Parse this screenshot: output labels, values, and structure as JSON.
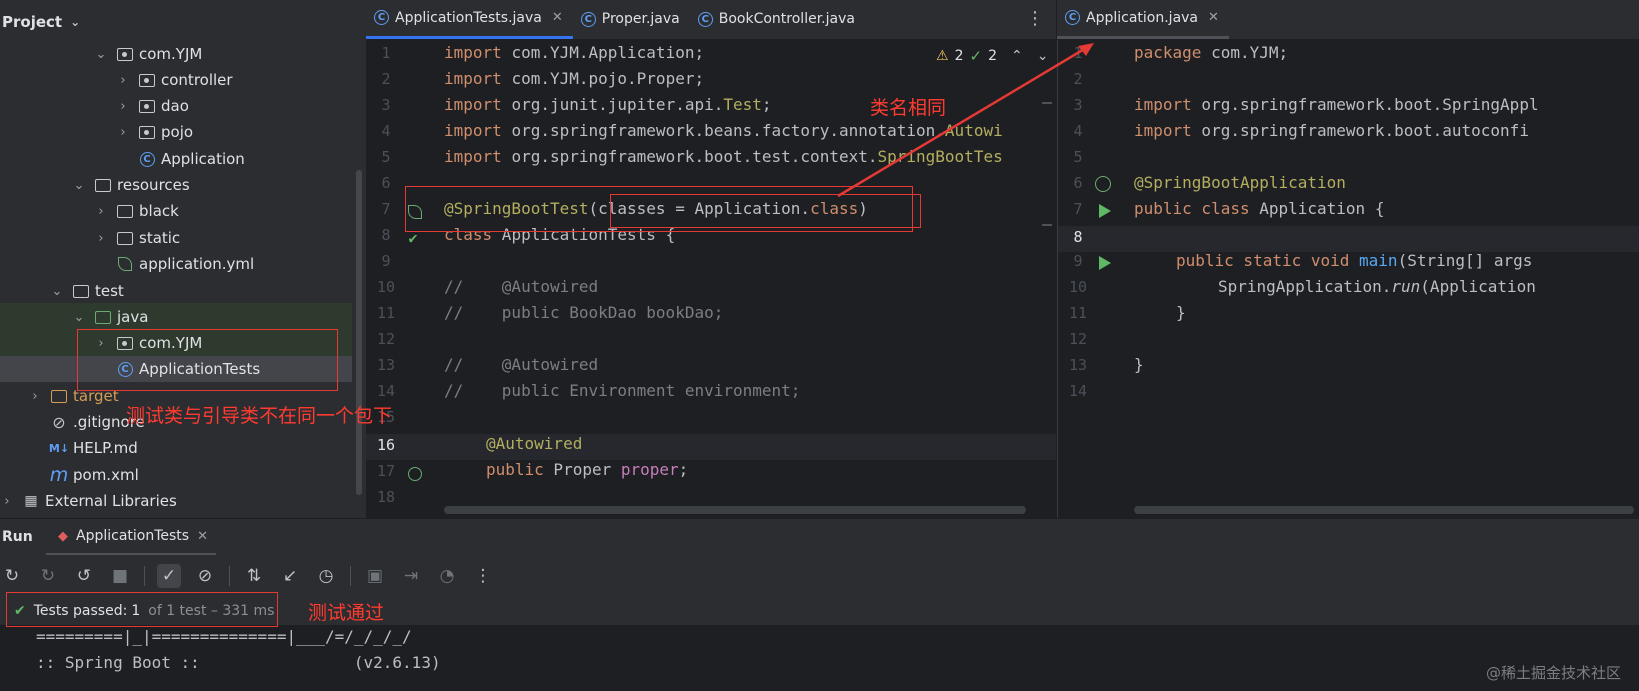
{
  "project": {
    "title": "Project",
    "tree": [
      {
        "label": "com.YJM",
        "type": "package"
      },
      {
        "label": "controller",
        "type": "package"
      },
      {
        "label": "dao",
        "type": "package"
      },
      {
        "label": "pojo",
        "type": "package"
      },
      {
        "label": "Application",
        "type": "class"
      },
      {
        "label": "resources",
        "type": "resources"
      },
      {
        "label": "black",
        "type": "folder"
      },
      {
        "label": "static",
        "type": "folder"
      },
      {
        "label": "application.yml",
        "type": "yml"
      },
      {
        "label": "test",
        "type": "folder"
      },
      {
        "label": "java",
        "type": "test-folder"
      },
      {
        "label": "com.YJM",
        "type": "package"
      },
      {
        "label": "ApplicationTests",
        "type": "class"
      },
      {
        "label": "target",
        "type": "orange-folder"
      },
      {
        "label": ".gitignore",
        "type": "ignore"
      },
      {
        "label": "HELP.md",
        "type": "md"
      },
      {
        "label": "pom.xml",
        "type": "maven"
      },
      {
        "label": "External Libraries",
        "type": "libs"
      }
    ]
  },
  "tabs_left": [
    {
      "label": "ApplicationTests.java"
    },
    {
      "label": "Proper.java"
    },
    {
      "label": "BookController.java"
    }
  ],
  "tabs_right": [
    {
      "label": "Application.java"
    }
  ],
  "inspections": {
    "warnings": "2",
    "ok": "2"
  },
  "editor_left": {
    "line_numbers": [
      "1",
      "2",
      "3",
      "4",
      "5",
      "6",
      "7",
      "8",
      "9",
      "10",
      "11",
      "12",
      "13",
      "14",
      "15",
      "16",
      "17",
      "18"
    ],
    "lines": {
      "l1": "com.YJM.Application;",
      "l2": "com.YJM.pojo.Proper;",
      "l3": "org.junit.jupiter.api.",
      "l3b": "Test",
      "l4": "org.springframework.beans.factory.annotation.",
      "l4b": "Autowi",
      "l5": "org.springframework.boot.test.context.",
      "l5b": "SpringBootTes",
      "l7a": "@SpringBootTest",
      "l7b": "(classes = Application.",
      "l7c": "class",
      "l7d": ")",
      "l8a": "class",
      "l8b": " ApplicationTests {",
      "l10": "//    @Autowired",
      "l11": "//    public BookDao bookDao;",
      "l13": "//    @Autowired",
      "l14": "//    public Environment environment;",
      "l16": "@Autowired",
      "l17a": "public",
      "l17b": " Proper ",
      "l17c": "proper",
      "l17d": ";",
      "import_kw": "import"
    }
  },
  "editor_right": {
    "line_numbers": [
      "1",
      "2",
      "3",
      "4",
      "5",
      "6",
      "7",
      "8",
      "9",
      "10",
      "11",
      "12",
      "13",
      "14"
    ],
    "lines": {
      "l1a": "package",
      "l1b": " com.YJM;",
      "l3": " org.springframework.boot.SpringAppl",
      "l4": " org.springframework.boot.autoconfi",
      "l6": "@SpringBootApplication",
      "l7a": "public class",
      "l7b": " Application {",
      "l9a": "public static void",
      "l9b": "main",
      "l9c": "(String[] args",
      "l10a": "SpringApplication.",
      "l10b": "run",
      "l10c": "(Application",
      "l11": "}",
      "l13": "}",
      "import_kw": "import"
    }
  },
  "run": {
    "title": "Run",
    "tab_label": "ApplicationTests",
    "tests_passed_label": "Tests passed:",
    "tests_passed_count": "1",
    "tests_detail": "of 1 test – 331 ms",
    "console": [
      "=========|_|==============|___/=/_/_/_/",
      ":: Spring Boot ::                (v2.6.13)"
    ]
  },
  "annotations": {
    "same_class_name": "类名相同",
    "not_same_package": "测试类与引导类不在同一个包下",
    "test_passed": "测试通过"
  },
  "watermark": "@稀土掘金技术社区",
  "colors": {
    "background": "#1e1f22",
    "panel": "#2b2d30",
    "accent": "#3574f0",
    "annotation_red": "#ff3b30",
    "keyword": "#cf8e6d",
    "annotation": "#b3ae60"
  }
}
